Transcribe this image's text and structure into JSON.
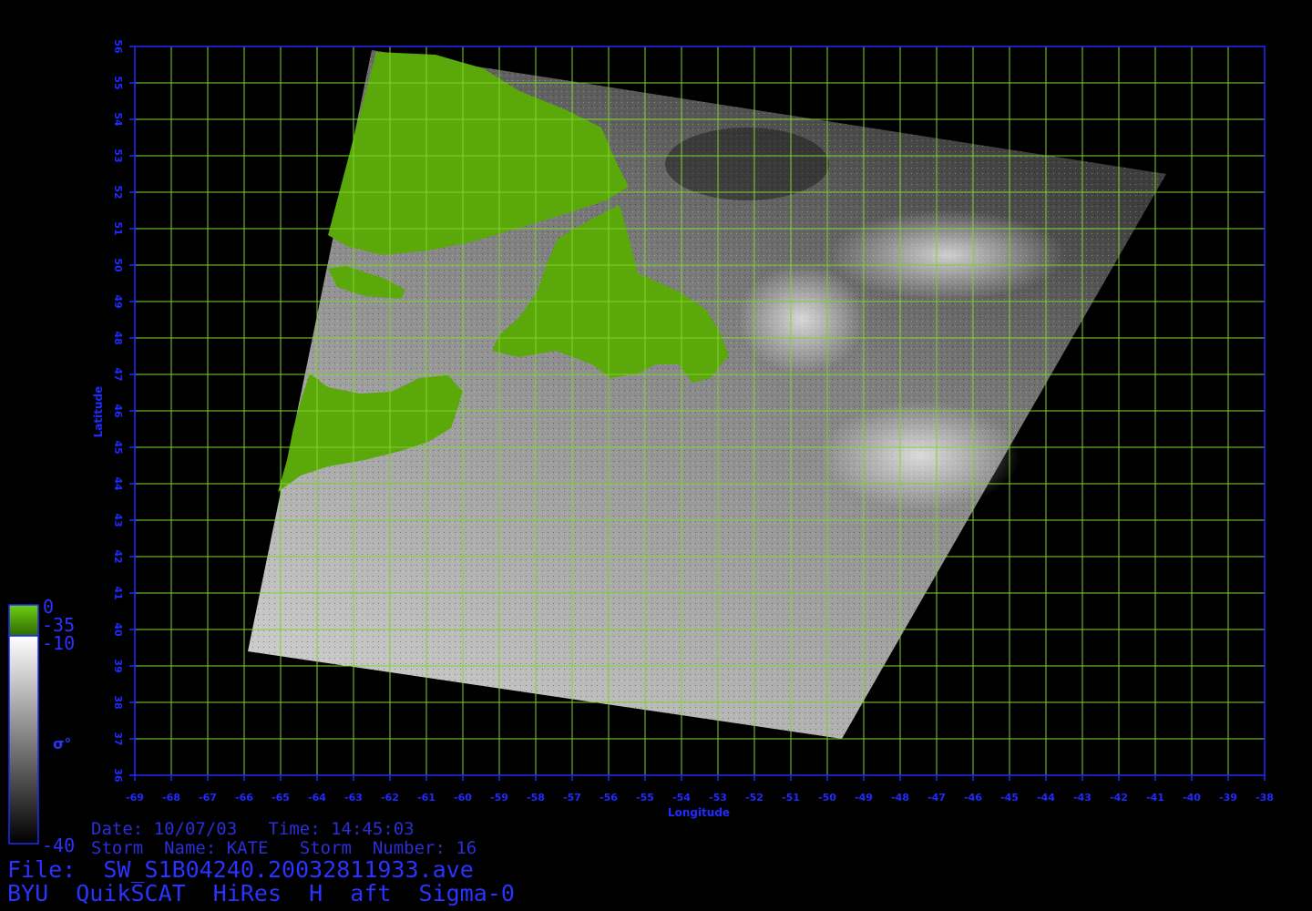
{
  "header": {
    "date_line": "Date: 10/07/03   Time: 14:45:03",
    "storm_line": "Storm  Name: KATE   Storm  Number: 16",
    "file_line": "File:  SW_S1B04240.20032811933.ave",
    "product_line": "BYU  QuikSCAT  HiRes  H  aft  Sigma-0"
  },
  "map": {
    "x_axis_label": "Longitude",
    "y_axis_label": "Latitude",
    "lon_ticks": [
      "-69",
      "-68",
      "-67",
      "-66",
      "-65",
      "-64",
      "-63",
      "-62",
      "-61",
      "-60",
      "-59",
      "-58",
      "-57",
      "-56",
      "-55",
      "-54",
      "-53",
      "-52",
      "-51",
      "-50",
      "-49",
      "-48",
      "-47",
      "-46",
      "-45",
      "-44",
      "-43",
      "-42",
      "-41",
      "-40",
      "-39",
      "-38"
    ],
    "lat_ticks": [
      "56",
      "55",
      "54",
      "53",
      "52",
      "51",
      "50",
      "49",
      "48",
      "47",
      "46",
      "45",
      "44",
      "43",
      "42",
      "41",
      "40",
      "39",
      "38",
      "37",
      "36"
    ],
    "lon_range": [
      -69,
      -38
    ],
    "lat_range": [
      36,
      56
    ],
    "grid": true,
    "grid_color": "#7dd62a",
    "frame_color": "#1f2bff",
    "land_color": "#5aa80a",
    "swath_corners_deg": [
      [
        -62.5,
        55.9
      ],
      [
        -40.7,
        52.5
      ],
      [
        -49.6,
        37.0
      ],
      [
        -65.9,
        39.4
      ]
    ]
  },
  "colorbar": {
    "land_label_top": "0",
    "land_label_bottom": "-35",
    "sea_label_top": "-10",
    "sea_label_bottom": "-40",
    "symbol": "σ°",
    "land_color": "#5aa80a",
    "sea_gradient": [
      "#ffffff",
      "#000000"
    ]
  }
}
